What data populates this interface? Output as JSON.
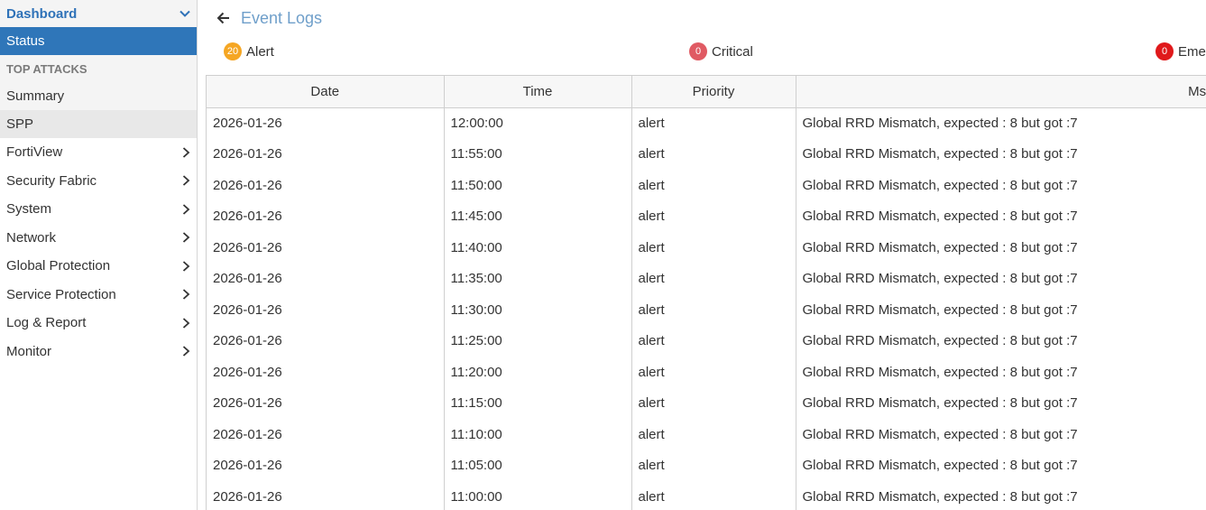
{
  "sidebar": {
    "header": "Dashboard",
    "active": "Status",
    "section": "TOP ATTACKS",
    "subitems": [
      "Summary",
      "SPP"
    ],
    "items": [
      "FortiView",
      "Security Fabric",
      "System",
      "Network",
      "Global Protection",
      "Service Protection",
      "Log & Report",
      "Monitor"
    ]
  },
  "page": {
    "title": "Event Logs"
  },
  "counts": [
    {
      "value": "20",
      "label": "Alert",
      "color": "#f5a623"
    },
    {
      "value": "0",
      "label": "Critical",
      "color": "#e05a63"
    },
    {
      "value": "0",
      "label": "Emer",
      "color": "#e0191b"
    }
  ],
  "table": {
    "columns": [
      "Date",
      "Time",
      "Priority",
      "Msg"
    ],
    "rows": [
      [
        "2026-01-26",
        "12:00:00",
        "alert",
        "Global RRD Mismatch, expected : 8 but got :7"
      ],
      [
        "2026-01-26",
        "11:55:00",
        "alert",
        "Global RRD Mismatch, expected : 8 but got :7"
      ],
      [
        "2026-01-26",
        "11:50:00",
        "alert",
        "Global RRD Mismatch, expected : 8 but got :7"
      ],
      [
        "2026-01-26",
        "11:45:00",
        "alert",
        "Global RRD Mismatch, expected : 8 but got :7"
      ],
      [
        "2026-01-26",
        "11:40:00",
        "alert",
        "Global RRD Mismatch, expected : 8 but got :7"
      ],
      [
        "2026-01-26",
        "11:35:00",
        "alert",
        "Global RRD Mismatch, expected : 8 but got :7"
      ],
      [
        "2026-01-26",
        "11:30:00",
        "alert",
        "Global RRD Mismatch, expected : 8 but got :7"
      ],
      [
        "2026-01-26",
        "11:25:00",
        "alert",
        "Global RRD Mismatch, expected : 8 but got :7"
      ],
      [
        "2026-01-26",
        "11:20:00",
        "alert",
        "Global RRD Mismatch, expected : 8 but got :7"
      ],
      [
        "2026-01-26",
        "11:15:00",
        "alert",
        "Global RRD Mismatch, expected : 8 but got :7"
      ],
      [
        "2026-01-26",
        "11:10:00",
        "alert",
        "Global RRD Mismatch, expected : 8 but got :7"
      ],
      [
        "2026-01-26",
        "11:05:00",
        "alert",
        "Global RRD Mismatch, expected : 8 but got :7"
      ],
      [
        "2026-01-26",
        "11:00:00",
        "alert",
        "Global RRD Mismatch, expected : 8 but got :7"
      ]
    ]
  }
}
